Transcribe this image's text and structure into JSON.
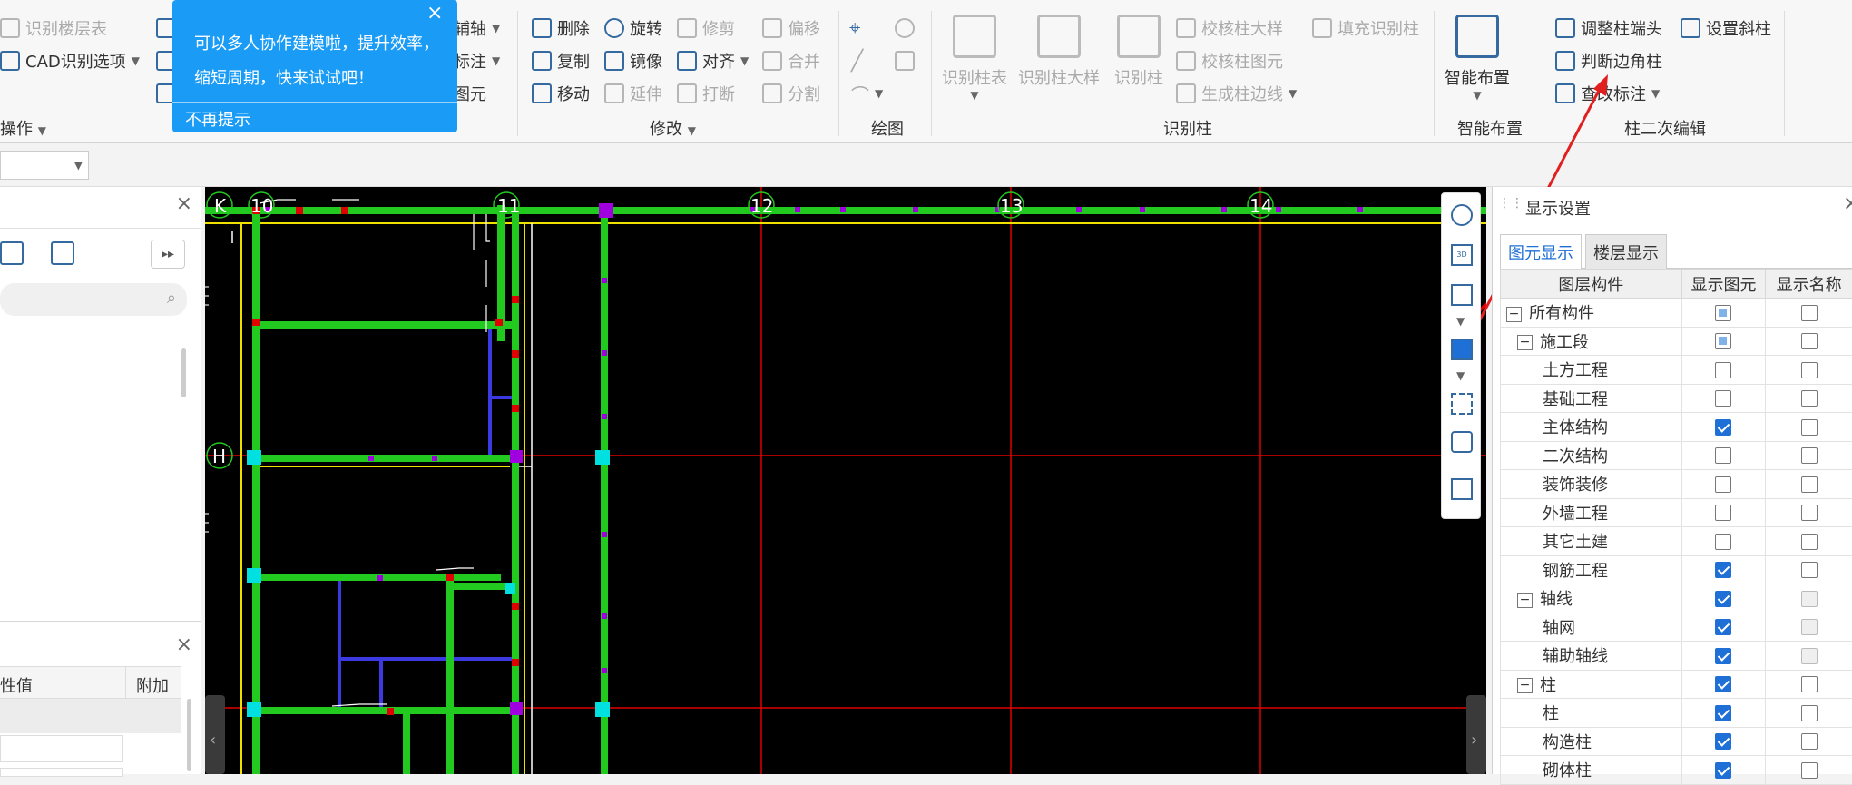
{
  "ribbon": {
    "col_a": {
      "item1": "识别楼层表",
      "item2": "CAD识别选项",
      "group_label": "操作"
    },
    "col_b": {
      "item1": "辅轴",
      "item2": "标注",
      "item3": "图元"
    },
    "modify": {
      "delete": "删除",
      "rotate": "旋转",
      "trim": "修剪",
      "offset": "偏移",
      "copy": "复制",
      "mirror": "镜像",
      "align": "对齐",
      "merge": "合并",
      "move": "移动",
      "extend": "延伸",
      "break": "打断",
      "split": "分割",
      "group_label": "修改"
    },
    "draw": {
      "group_label": "绘图"
    },
    "identify_column": {
      "table": "识别柱表",
      "detail": "识别柱大样",
      "column": "识别柱",
      "check_detail": "校核柱大样",
      "fill": "填充识别柱",
      "check_elem": "校核柱图元",
      "gen_edge": "生成柱边线",
      "group_label": "识别柱"
    },
    "smart_layout": {
      "button": "智能布置",
      "group_label": "智能布置"
    },
    "column_edit": {
      "adjust_end": "调整柱端头",
      "set_slant": "设置斜柱",
      "judge_corner": "判断边角柱",
      "view_label": "查改标注",
      "group_label": "柱二次编辑"
    }
  },
  "popup": {
    "line1": "可以多人协作建模啦，提升效率，",
    "line2": "缩短周期，快来试试吧！",
    "dismiss": "不再提示",
    "close": "×"
  },
  "left_panel": {
    "close": "×",
    "prop_close": "×",
    "prop_col_value": "性值",
    "prop_col_extra": "附加"
  },
  "canvas": {
    "axis_labels": {
      "k": "K",
      "h": "H",
      "a10": "10",
      "a11": "11",
      "a12": "12",
      "a13": "13",
      "a14": "14"
    },
    "colors": {
      "background": "#000000",
      "wall": "#22c91e",
      "axis": "#e00000",
      "beam": "#3a3ae0",
      "edge": "#f0e000",
      "column": "#00e0e0",
      "node": "#a000e0"
    }
  },
  "display_settings": {
    "title": "显示设置",
    "close": "×",
    "tabs": [
      "图元显示",
      "楼层显示"
    ],
    "active_tab": 0,
    "headers": [
      "图层构件",
      "显示图元",
      "显示名称"
    ],
    "rows": [
      {
        "label": "所有构件",
        "level": 0,
        "toggle": "−",
        "show": "partial",
        "name": "off"
      },
      {
        "label": "施工段",
        "level": 1,
        "toggle": "−",
        "show": "partial",
        "name": "off"
      },
      {
        "label": "土方工程",
        "level": 2,
        "toggle": "",
        "show": "off",
        "name": "off"
      },
      {
        "label": "基础工程",
        "level": 2,
        "toggle": "",
        "show": "off",
        "name": "off"
      },
      {
        "label": "主体结构",
        "level": 2,
        "toggle": "",
        "show": "on",
        "name": "off"
      },
      {
        "label": "二次结构",
        "level": 2,
        "toggle": "",
        "show": "off",
        "name": "off"
      },
      {
        "label": "装饰装修",
        "level": 2,
        "toggle": "",
        "show": "off",
        "name": "off"
      },
      {
        "label": "外墙工程",
        "level": 2,
        "toggle": "",
        "show": "off",
        "name": "off"
      },
      {
        "label": "其它土建",
        "level": 2,
        "toggle": "",
        "show": "off",
        "name": "off"
      },
      {
        "label": "钢筋工程",
        "level": 2,
        "toggle": "",
        "show": "on",
        "name": "off"
      },
      {
        "label": "轴线",
        "level": 1,
        "toggle": "−",
        "show": "on",
        "name": "dim"
      },
      {
        "label": "轴网",
        "level": 2,
        "toggle": "",
        "show": "on",
        "name": "dim"
      },
      {
        "label": "辅助轴线",
        "level": 2,
        "toggle": "",
        "show": "on",
        "name": "dim"
      },
      {
        "label": "柱",
        "level": 1,
        "toggle": "−",
        "show": "on",
        "name": "off"
      },
      {
        "label": "柱",
        "level": 2,
        "toggle": "",
        "show": "on",
        "name": "off"
      },
      {
        "label": "构造柱",
        "level": 2,
        "toggle": "",
        "show": "on",
        "name": "off"
      },
      {
        "label": "砌体柱",
        "level": 2,
        "toggle": "",
        "show": "on",
        "name": "off"
      }
    ]
  }
}
